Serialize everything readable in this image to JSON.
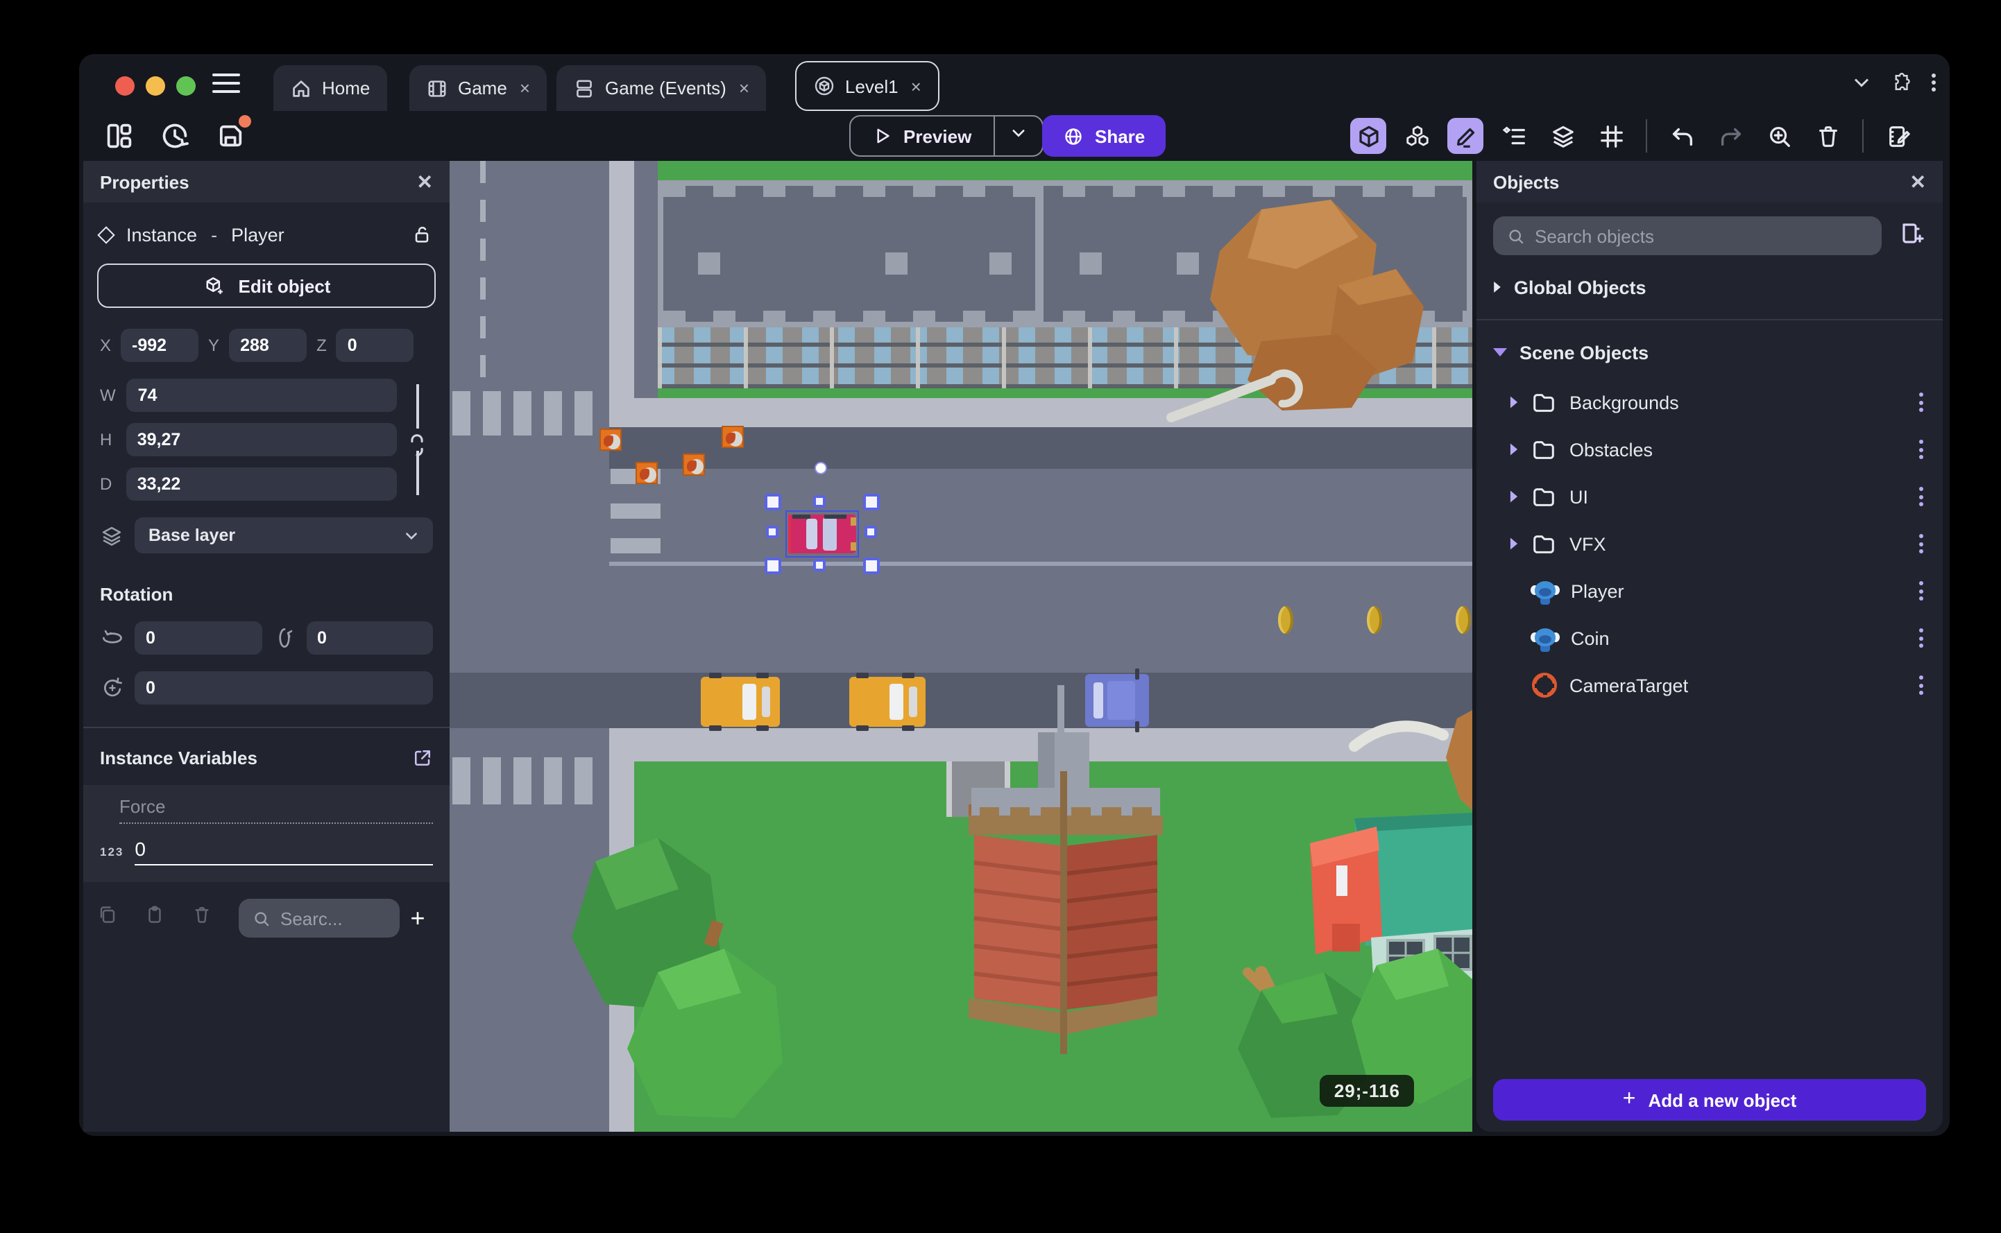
{
  "window": {
    "tabs": [
      {
        "label": "Home",
        "icon": "home-icon",
        "closable": false,
        "active": false
      },
      {
        "label": "Game",
        "icon": "film-icon",
        "closable": true,
        "active": false,
        "close_glyph": "×"
      },
      {
        "label": "Game (Events)",
        "icon": "events-sheet-icon",
        "closable": true,
        "active": false,
        "close_glyph": "×"
      },
      {
        "label": "Level1",
        "icon": "scene-cube-icon",
        "closable": true,
        "active": true,
        "close_glyph": "×"
      }
    ],
    "titlebar_icons": [
      "chevron-down-icon",
      "extensions-puzzle-icon",
      "kebab-menu-icon"
    ],
    "traffic_lights": {
      "close": "#ee5f52",
      "minimize": "#f5bd4e",
      "zoom": "#61c354"
    }
  },
  "toolbar": {
    "left_icons": [
      "panels-layout-icon",
      "history-icon",
      "save-icon"
    ],
    "save_has_unsaved_dot": true,
    "preview_label": "Preview",
    "share_label": "Share",
    "right_icons": [
      "cube-3d-icon",
      "objects-cubes-icon",
      "pencil-icon",
      "instances-list-icon",
      "layers-icon",
      "grid-icon",
      "undo-icon",
      "redo-icon",
      "zoom-in-icon",
      "trash-icon",
      "notebook-edit-icon"
    ],
    "active_right_icons": [
      "cube-3d-icon",
      "pencil-icon"
    ]
  },
  "properties": {
    "title": "Properties",
    "instance_type": "Instance",
    "instance_dash": "-",
    "instance_name": "Player",
    "edit_object_label": "Edit object",
    "position": {
      "x_label": "X",
      "x": "-992",
      "y_label": "Y",
      "y": "288",
      "z_label": "Z",
      "z": "0"
    },
    "size": {
      "w_label": "W",
      "w": "74",
      "h_label": "H",
      "h": "39,27",
      "d_label": "D",
      "d": "33,22"
    },
    "layer_value": "Base layer",
    "rotation_title": "Rotation",
    "rotation": {
      "x": "0",
      "y": "0",
      "z": "0"
    },
    "variables_title": "Instance Variables",
    "variables": [
      {
        "name": "Force",
        "type_badge": "123",
        "value": "0"
      }
    ],
    "variables_search_placeholder": "Searc...",
    "add_variable_glyph": "+"
  },
  "objects": {
    "title": "Objects",
    "search_placeholder": "Search objects",
    "global_label": "Global Objects",
    "scene_label": "Scene Objects",
    "items": [
      {
        "label": "Backgrounds",
        "kind": "folder"
      },
      {
        "label": "Obstacles",
        "kind": "folder"
      },
      {
        "label": "UI",
        "kind": "folder"
      },
      {
        "label": "VFX",
        "kind": "folder"
      },
      {
        "label": "Player",
        "kind": "sprite"
      },
      {
        "label": "Coin",
        "kind": "sprite"
      },
      {
        "label": "CameraTarget",
        "kind": "target"
      }
    ],
    "add_label": "Add a new object"
  },
  "canvas": {
    "coordinates_badge": "29;-116",
    "selected_instance": "Player car"
  },
  "colors": {
    "accent_purple": "#5a30dd",
    "add_button_purple": "#4f23d3",
    "active_tool_bg": "#b3a2f3",
    "panel_bg": "#21242e",
    "panel_header_bg": "#2a2d38",
    "road": "#6d7284",
    "road_dark": "#575c6d",
    "sidewalk": "#b9bcc6",
    "grass": "#4aa44e",
    "selection_blue": "#4450e0",
    "unsaved_dot": "#ef7d5a"
  }
}
